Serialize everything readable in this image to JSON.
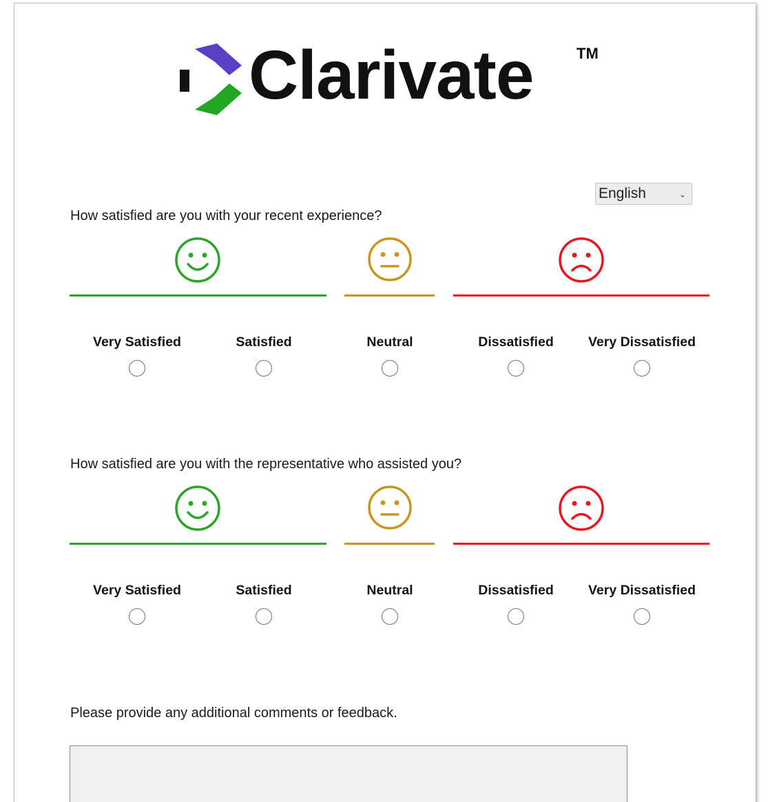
{
  "logo": {
    "wordmark": "Clarivate",
    "tm": "TM"
  },
  "language_select": {
    "value": "English"
  },
  "questions": [
    {
      "text": "How satisfied are you with your recent experience?",
      "options": [
        "Very Satisfied",
        "Satisfied",
        "Neutral",
        "Dissatisfied",
        "Very Dissatisfied"
      ]
    },
    {
      "text": "How satisfied are you with the representative who assisted you?",
      "options": [
        "Very Satisfied",
        "Satisfied",
        "Neutral",
        "Dissatisfied",
        "Very Dissatisfied"
      ]
    }
  ],
  "comments": {
    "prompt": "Please provide any additional comments or feedback.",
    "value": ""
  },
  "colors": {
    "satisfied": "#2aa52a",
    "neutral": "#c8961c",
    "dissatisfied": "#e8191e",
    "logo_purple": "#5b3fc4",
    "logo_green": "#22a722"
  },
  "icons": [
    "smiley-happy-icon",
    "smiley-neutral-icon",
    "smiley-sad-icon",
    "clarivate-logo-mark-icon",
    "chevron-down-icon"
  ]
}
